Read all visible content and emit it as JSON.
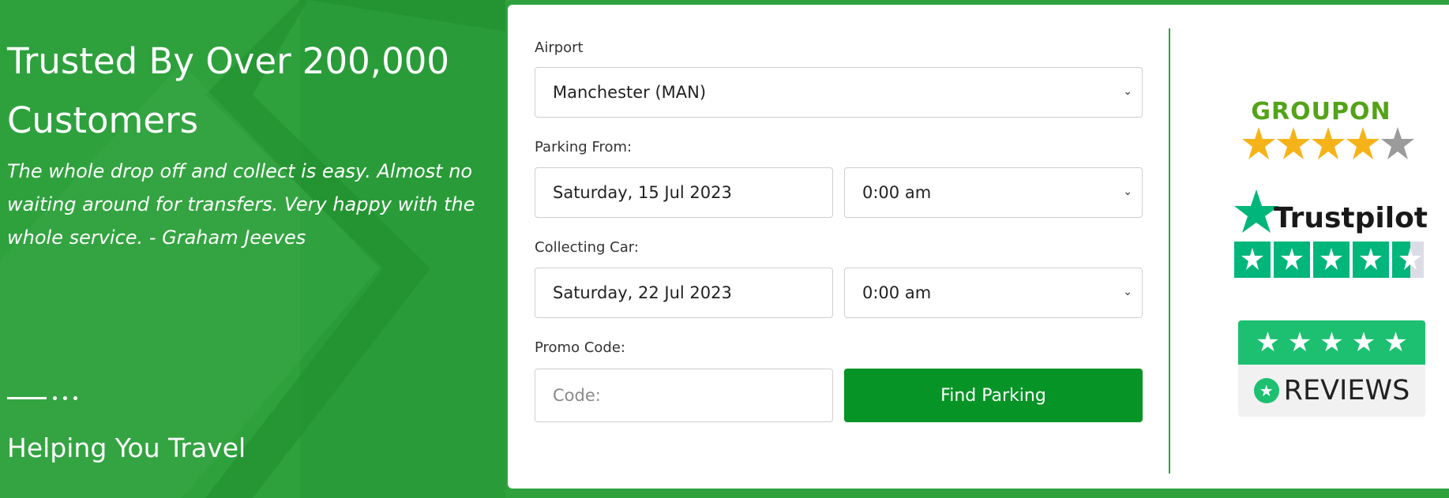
{
  "hero": {
    "title": "Trusted By Over 200,000 Customers",
    "quote": "The whole drop off and collect is easy. Almost no waiting around for transfers. Very happy with the whole service. - Graham Jeeves",
    "tagline": "Helping You Travel"
  },
  "form": {
    "airport_label": "Airport",
    "airport_value": "Manchester (MAN)",
    "parking_from_label": "Parking From:",
    "parking_from_date": "Saturday, 15 Jul 2023",
    "parking_from_time": "0:00 am",
    "collecting_label": "Collecting Car:",
    "collecting_date": "Saturday, 22 Jul 2023",
    "collecting_time": "0:00 am",
    "promo_label": "Promo Code:",
    "promo_placeholder": "Code:",
    "submit_label": "Find Parking"
  },
  "badges": {
    "groupon": {
      "name": "GROUPON",
      "rating": 4,
      "max": 5
    },
    "trustpilot": {
      "name": "Trustpilot",
      "rating": 4.5,
      "max": 5
    },
    "reviews_io": {
      "name": "REVIEWS",
      "rating": 4.5,
      "max": 5
    }
  },
  "colors": {
    "brand_green": "#2ea13d",
    "button_green": "#079426",
    "groupon_green": "#53a318",
    "trustpilot_green": "#00b67a",
    "reviews_green": "#1cc070",
    "star_gold": "#f6b319"
  },
  "icons": [
    "chevron-down-icon",
    "star-icon",
    "trustpilot-star-icon",
    "reviews-badge-icon"
  ]
}
